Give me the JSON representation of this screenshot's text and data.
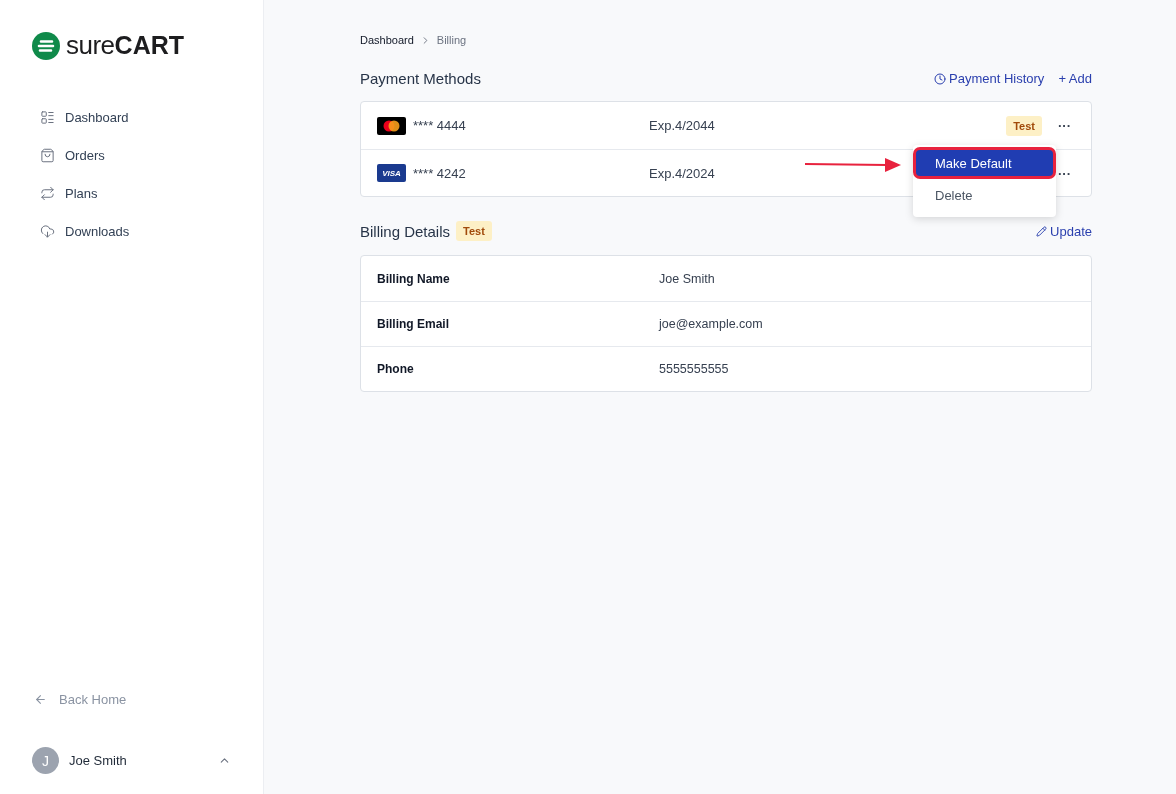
{
  "logo": {
    "light": "sure",
    "bold": "CART"
  },
  "sidebar": {
    "items": [
      {
        "kind": "dashboard",
        "label": "Dashboard"
      },
      {
        "kind": "orders",
        "label": "Orders"
      },
      {
        "kind": "plans",
        "label": "Plans"
      },
      {
        "kind": "downloads",
        "label": "Downloads"
      }
    ],
    "back_link": "Back Home",
    "user": {
      "initial": "J",
      "name": "Joe Smith"
    }
  },
  "breadcrumb": [
    "Dashboard",
    "Billing"
  ],
  "payment_methods": {
    "title": "Payment Methods",
    "actions": [
      {
        "kind": "history",
        "label": "Payment History"
      },
      {
        "kind": "add",
        "label": "+ Add"
      }
    ],
    "rows": [
      {
        "kind": "mastercard",
        "number": "**** 4444",
        "expiry": "Exp.4/2044",
        "badge": "Test",
        "menu": "···"
      },
      {
        "kind": "visa",
        "brand_text": "VISA",
        "number": "**** 4242",
        "expiry": "Exp.4/2024",
        "menu": "···"
      }
    ],
    "dropdown": [
      {
        "label": "Make Default",
        "selected": true
      },
      {
        "label": "Delete",
        "selected": false
      }
    ]
  },
  "billing_details": {
    "title": "Billing Details",
    "badge": "Test",
    "action": "Update",
    "rows": [
      {
        "label": "Billing Name",
        "value": "Joe Smith"
      },
      {
        "label": "Billing Email",
        "value": "joe@example.com"
      },
      {
        "label": "Phone",
        "value": "5555555555"
      }
    ]
  }
}
